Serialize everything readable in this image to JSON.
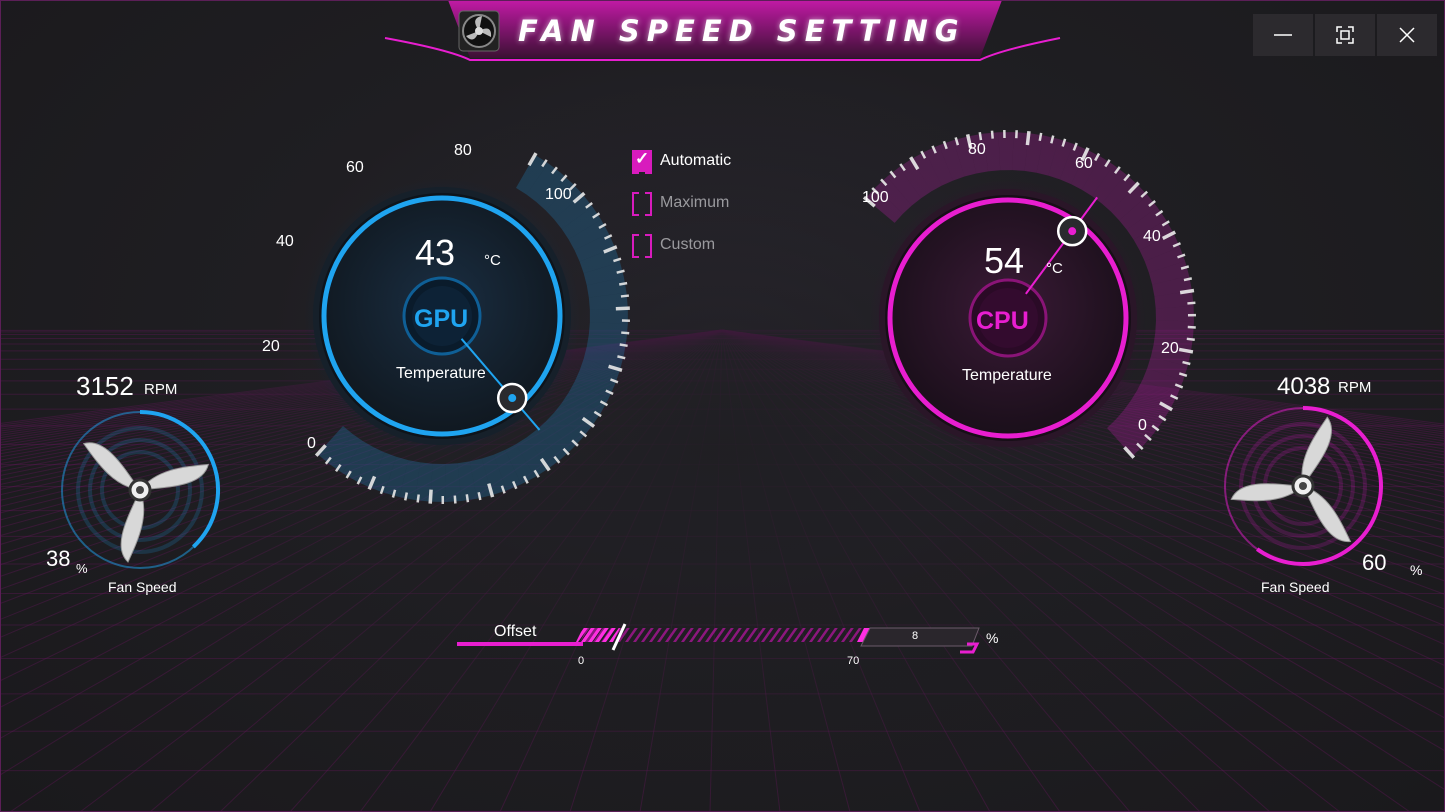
{
  "window": {
    "title": "FAN SPEED SETTING",
    "buttons": {
      "minimize": "minimize-icon",
      "maximize": "maximize-icon",
      "close": "close-icon"
    }
  },
  "gpu": {
    "temperature": "43",
    "unit": "°C",
    "badge": "GPU",
    "label": "Temperature",
    "ticks": [
      "0",
      "20",
      "40",
      "60",
      "80",
      "100"
    ],
    "rpm": "3152",
    "rpm_unit": "RPM",
    "fan_speed": "38",
    "fan_unit": "%",
    "fan_label": "Fan Speed",
    "color": "#1fa4f0"
  },
  "cpu": {
    "temperature": "54",
    "unit": "°C",
    "badge": "CPU",
    "label": "Temperature",
    "ticks": [
      "0",
      "20",
      "40",
      "60",
      "80",
      "100"
    ],
    "rpm": "4038",
    "rpm_unit": "RPM",
    "fan_speed": "60",
    "fan_unit": "%",
    "fan_label": "Fan Speed",
    "color": "#e81ed0"
  },
  "modes": [
    {
      "label": "Automatic",
      "checked": true
    },
    {
      "label": "Maximum",
      "checked": false
    },
    {
      "label": "Custom",
      "checked": false
    }
  ],
  "offset": {
    "label": "Offset",
    "min": "0",
    "max": "70",
    "value": "8",
    "unit": "%"
  },
  "accent": "#e01fc9"
}
